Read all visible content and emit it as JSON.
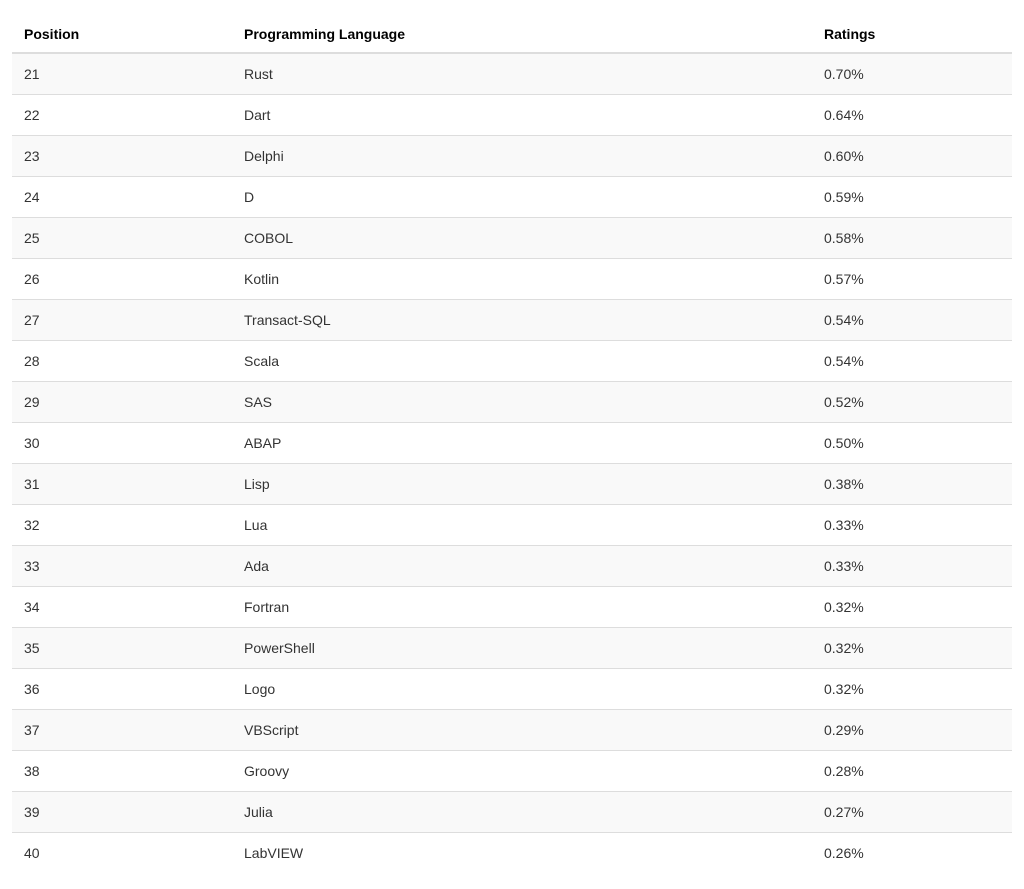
{
  "table": {
    "headers": {
      "position": "Position",
      "language": "Programming Language",
      "ratings": "Ratings"
    },
    "rows": [
      {
        "position": "21",
        "language": "Rust",
        "ratings": "0.70%"
      },
      {
        "position": "22",
        "language": "Dart",
        "ratings": "0.64%"
      },
      {
        "position": "23",
        "language": "Delphi",
        "ratings": "0.60%"
      },
      {
        "position": "24",
        "language": "D",
        "ratings": "0.59%"
      },
      {
        "position": "25",
        "language": "COBOL",
        "ratings": "0.58%"
      },
      {
        "position": "26",
        "language": "Kotlin",
        "ratings": "0.57%"
      },
      {
        "position": "27",
        "language": "Transact-SQL",
        "ratings": "0.54%"
      },
      {
        "position": "28",
        "language": "Scala",
        "ratings": "0.54%"
      },
      {
        "position": "29",
        "language": "SAS",
        "ratings": "0.52%"
      },
      {
        "position": "30",
        "language": "ABAP",
        "ratings": "0.50%"
      },
      {
        "position": "31",
        "language": "Lisp",
        "ratings": "0.38%"
      },
      {
        "position": "32",
        "language": "Lua",
        "ratings": "0.33%"
      },
      {
        "position": "33",
        "language": "Ada",
        "ratings": "0.33%"
      },
      {
        "position": "34",
        "language": "Fortran",
        "ratings": "0.32%"
      },
      {
        "position": "35",
        "language": "PowerShell",
        "ratings": "0.32%"
      },
      {
        "position": "36",
        "language": "Logo",
        "ratings": "0.32%"
      },
      {
        "position": "37",
        "language": "VBScript",
        "ratings": "0.29%"
      },
      {
        "position": "38",
        "language": "Groovy",
        "ratings": "0.28%"
      },
      {
        "position": "39",
        "language": "Julia",
        "ratings": "0.27%"
      },
      {
        "position": "40",
        "language": "LabVIEW",
        "ratings": "0.26%"
      }
    ]
  }
}
